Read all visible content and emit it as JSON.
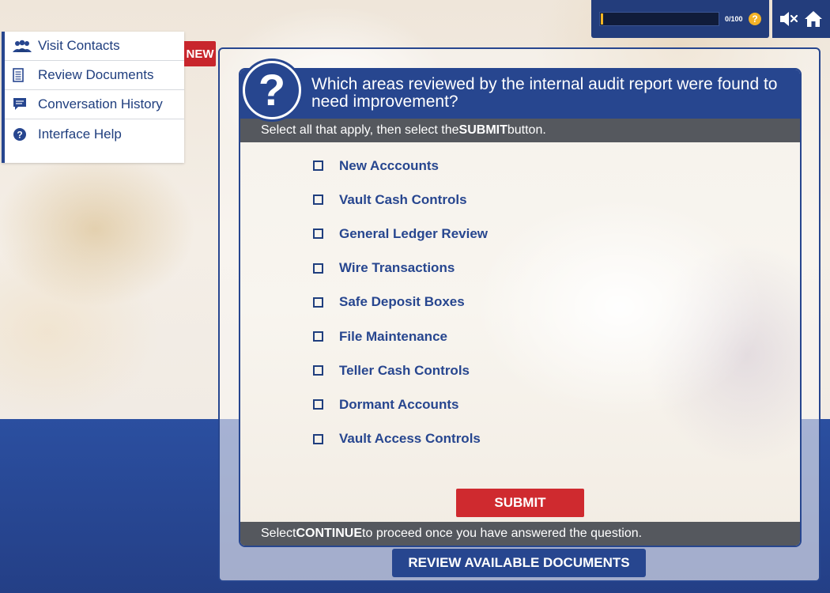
{
  "progress": {
    "value": 0,
    "max": 100,
    "label": "0/100",
    "help_glyph": "?",
    "fill_color": "#f4b623"
  },
  "toolbar": {
    "mute_icon": "speaker-muted-icon",
    "home_icon": "home-icon"
  },
  "side_menu": {
    "items": [
      {
        "label": "Visit Contacts",
        "icon": "people-icon"
      },
      {
        "label": "Review Documents",
        "icon": "document-icon"
      },
      {
        "label": "Conversation History",
        "icon": "chat-icon"
      },
      {
        "label": "Interface Help",
        "icon": "help-icon"
      }
    ],
    "new_badge": "NEW"
  },
  "question": {
    "icon_glyph": "?",
    "title": "Which areas reviewed by the internal audit report were found to need improvement?",
    "instruction_prefix": "Select all that apply, then select the ",
    "instruction_bold": "SUBMIT",
    "instruction_suffix": " button.",
    "options": [
      "New Acccounts",
      "Vault Cash Controls",
      "General Ledger Review",
      "Wire Transactions",
      "Safe Deposit Boxes",
      "File Maintenance",
      "Teller Cash Controls",
      "Dormant Accounts",
      "Vault Access Controls"
    ],
    "submit_label": "SUBMIT",
    "continue_prefix": "Select ",
    "continue_bold": "CONTINUE",
    "continue_suffix": " to proceed once you have answered the question."
  },
  "review_button_label": "REVIEW AVAILABLE DOCUMENTS",
  "colors": {
    "brand_blue": "#27468f",
    "submit_red": "#cf2a2f",
    "bar_gray": "#55585e",
    "accent_yellow": "#f2b227"
  }
}
